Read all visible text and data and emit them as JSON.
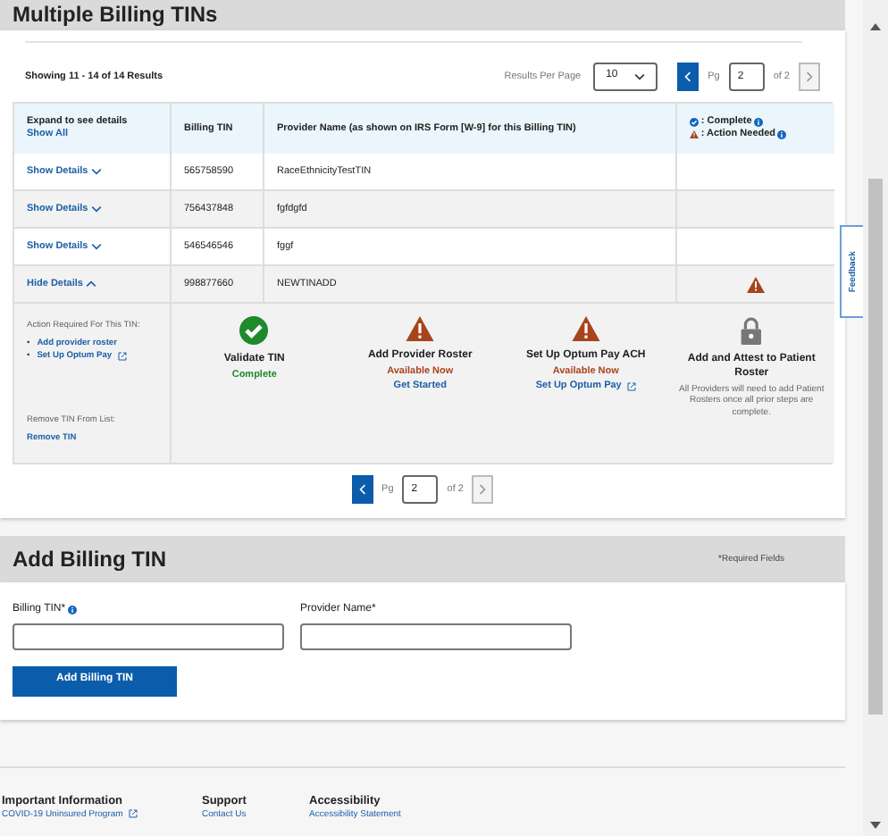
{
  "page_title": "Multiple Billing TINs",
  "results_summary": "Showing 11 - 14 of 14 Results",
  "results_per_page": {
    "label": "Results Per Page",
    "value": "10"
  },
  "pagination_top": {
    "pg_label": "Pg",
    "page": "2",
    "of_label": "of 2",
    "prev_disabled": false,
    "next_disabled": true
  },
  "table": {
    "columns": [
      {
        "title": "Expand to see details",
        "link": "Show All"
      },
      {
        "title": "Billing TIN"
      },
      {
        "title": "Provider Name (as shown on IRS Form [W-9] for this Billing TIN)"
      }
    ],
    "legend": [
      {
        "kind": "complete",
        "label": ": Complete"
      },
      {
        "kind": "action",
        "label": ": Action Needed"
      }
    ],
    "rows": [
      {
        "toggle": "Show Details",
        "expanded": false,
        "tin": "565758590",
        "name": "RaceEthnicityTestTIN",
        "action_needed": false
      },
      {
        "toggle": "Show Details",
        "expanded": false,
        "tin": "756437848",
        "name": "fgfdgfd",
        "action_needed": false
      },
      {
        "toggle": "Show Details",
        "expanded": false,
        "tin": "546546546",
        "name": "fggf",
        "action_needed": false
      },
      {
        "toggle": "Hide Details",
        "expanded": true,
        "tin": "998877660",
        "name": "NEWTINADD",
        "action_needed": true,
        "details": {
          "actions_label": "Action Required For This TIN:",
          "actions": [
            {
              "bullet": "•",
              "label": "Add provider roster"
            },
            {
              "bullet": "•",
              "label": "Set Up Optum Pay",
              "external": true
            }
          ],
          "remove_label": "Remove TIN From List:",
          "remove_link": "Remove TIN",
          "steps": [
            {
              "kind": "complete",
              "title": "Validate TIN",
              "status": "Complete"
            },
            {
              "kind": "action",
              "title": "Add Provider Roster",
              "status": "Available Now",
              "link": "Get Started"
            },
            {
              "kind": "action",
              "title": "Set Up Optum Pay ACH",
              "status": "Available Now",
              "link": "Set Up Optum Pay",
              "external": true
            },
            {
              "kind": "locked",
              "title": "Add and Attest to Patient Roster",
              "note": "All Providers will need to add Patient Rosters once all prior steps are complete."
            }
          ]
        }
      }
    ]
  },
  "pagination_bottom": {
    "pg_label": "Pg",
    "page": "2",
    "of_label": "of 2",
    "prev_disabled": false,
    "next_disabled": true
  },
  "add_form": {
    "title": "Add Billing TIN",
    "required_note": "*Required Fields",
    "fields": [
      {
        "label": "Billing TIN*",
        "info": true
      },
      {
        "label": "Provider Name*"
      }
    ],
    "button": "Add Billing TIN"
  },
  "footer": [
    {
      "heading": "Important Information",
      "link": "COVID-19 Uninsured Program",
      "external": true
    },
    {
      "heading": "Support",
      "link": "Contact Us"
    },
    {
      "heading": "Accessibility",
      "link": "Accessibility Statement"
    }
  ],
  "feedback_tab": "Feedback"
}
